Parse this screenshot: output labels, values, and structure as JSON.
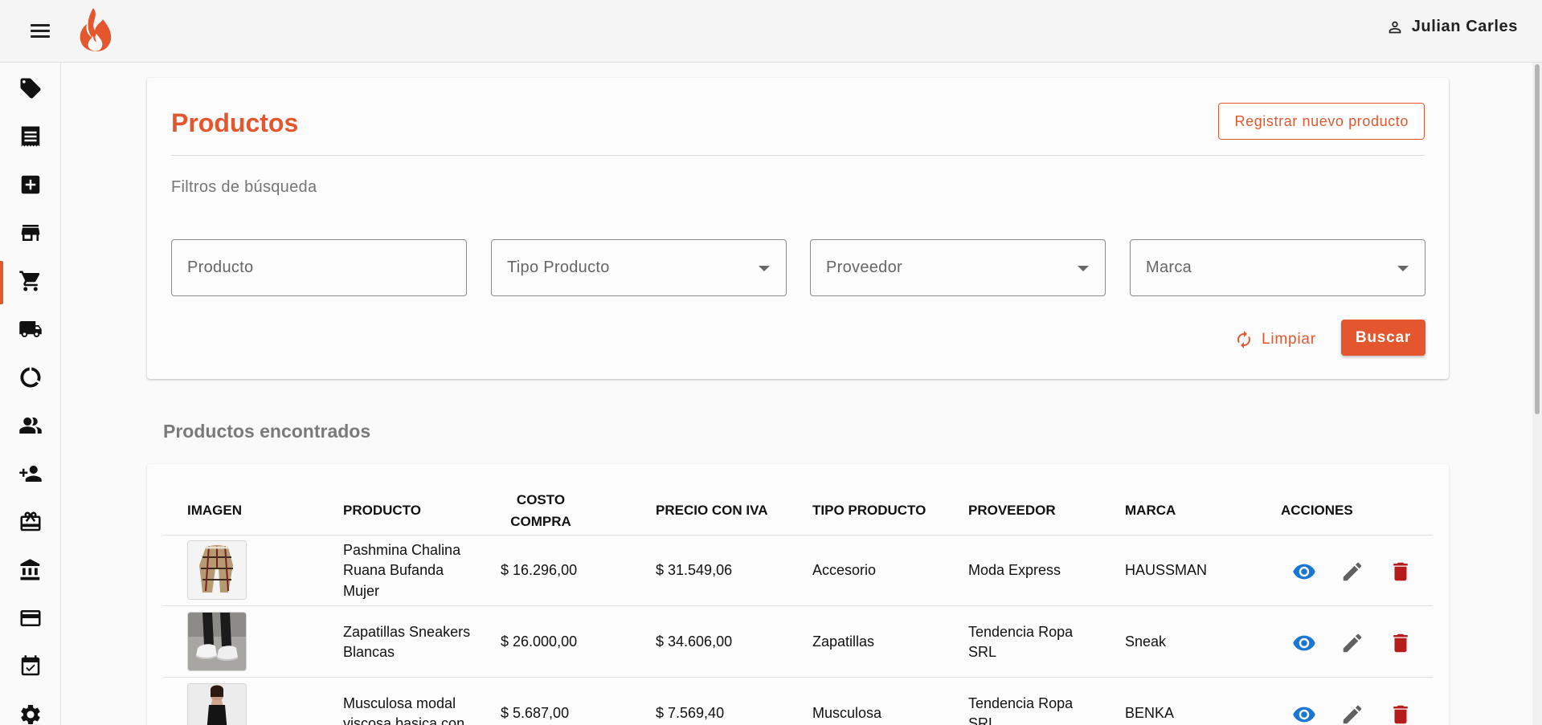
{
  "header": {
    "user_name": "Julian Carles",
    "icons": {
      "menu": "menu-icon",
      "logo": "flame-logo",
      "user": "person-icon"
    },
    "brand_color": "#e4572e"
  },
  "sidebar": {
    "items": [
      {
        "icon": "tag-icon"
      },
      {
        "icon": "receipt-icon"
      },
      {
        "icon": "add-box-icon"
      },
      {
        "icon": "store-icon"
      },
      {
        "icon": "cart-icon",
        "active": true
      },
      {
        "icon": "truck-icon"
      },
      {
        "icon": "donut-chart-icon"
      },
      {
        "icon": "people-icon"
      },
      {
        "icon": "person-add-icon"
      },
      {
        "icon": "card-giftcard-icon"
      },
      {
        "icon": "bank-icon"
      },
      {
        "icon": "credit-card-icon"
      },
      {
        "icon": "event-available-icon"
      },
      {
        "icon": "settings-icon"
      }
    ]
  },
  "filters": {
    "title": "Productos",
    "register_button": "Registrar nuevo producto",
    "subtitle": "Filtros de búsqueda",
    "fields": {
      "producto": "Producto",
      "tipo_producto": "Tipo Producto",
      "proveedor": "Proveedor",
      "marca": "Marca"
    },
    "clear_button": "Limpiar",
    "search_button": "Buscar"
  },
  "results": {
    "title": "Productos encontrados",
    "columns": {
      "imagen": "IMAGEN",
      "producto": "PRODUCTO",
      "costo": "COSTO COMPRA",
      "precio": "PRECIO CON IVA",
      "tipo": "TIPO PRODUCTO",
      "proveedor": "PROVEEDOR",
      "marca": "MARCA",
      "acciones": "ACCIONES"
    },
    "rows": [
      {
        "producto": "Pashmina Chalina Ruana Bufanda Mujer",
        "costo": "$ 16.296,00",
        "precio": "$ 31.549,06",
        "tipo": "Accesorio",
        "proveedor": "Moda Express",
        "marca": "HAUSSMAN",
        "image": "scarf-photo"
      },
      {
        "producto": "Zapatillas Sneakers Blancas",
        "costo": "$ 26.000,00",
        "precio": "$ 34.606,00",
        "tipo": "Zapatillas",
        "proveedor": "Tendencia Ropa SRL",
        "marca": "Sneak",
        "image": "sneakers-photo"
      },
      {
        "producto": "Musculosa modal viscosa basica con",
        "costo": "$ 5.687,00",
        "precio": "$ 7.569,40",
        "tipo": "Musculosa",
        "proveedor": "Tendencia Ropa SRL",
        "marca": "BENKA",
        "image": "tank-top-photo"
      }
    ],
    "action_colors": {
      "view": "#1976d2",
      "edit": "#616161",
      "delete": "#b71c1c"
    }
  }
}
